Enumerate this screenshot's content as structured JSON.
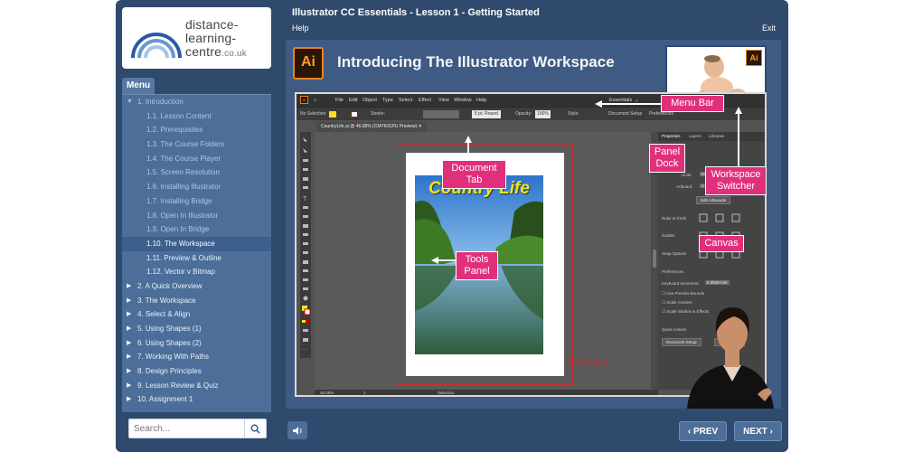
{
  "logo": {
    "line1": "distance-",
    "line2": "learning-",
    "line3": "centre",
    "line3_suffix": ".co.uk"
  },
  "header": {
    "course_title": "Illustrator CC Essentials - Lesson 1 - Getting Started",
    "help": "Help",
    "exit": "Exit"
  },
  "menu": {
    "tab_label": "Menu",
    "items": [
      {
        "label": "1. Introduction",
        "level": "top",
        "caret": "▼",
        "state": "open"
      },
      {
        "label": "1.1. Lesson Content",
        "level": "sub"
      },
      {
        "label": "1.2. Prerequisites",
        "level": "sub"
      },
      {
        "label": "1.3. The Course Folders",
        "level": "sub"
      },
      {
        "label": "1.4. The Course Player",
        "level": "sub"
      },
      {
        "label": "1.5. Screen Resolution",
        "level": "sub"
      },
      {
        "label": "1.6. Installing Illustrator",
        "level": "sub"
      },
      {
        "label": "1.7. Installing Bridge",
        "level": "sub"
      },
      {
        "label": "1.8. Open In Illustrator",
        "level": "sub"
      },
      {
        "label": "1.9. Open In Bridge",
        "level": "sub"
      },
      {
        "label": "1.10. The Workspace",
        "level": "sub",
        "state": "active"
      },
      {
        "label": "1.11. Preview & Outline",
        "level": "sub"
      },
      {
        "label": "1.12. Vector v Bitmap",
        "level": "sub"
      },
      {
        "label": "2. A Quick Overview",
        "level": "top",
        "caret": "▶"
      },
      {
        "label": "3. The Workspace",
        "level": "top",
        "caret": "▶"
      },
      {
        "label": "4. Select & Align",
        "level": "top",
        "caret": "▶"
      },
      {
        "label": "5. Using Shapes (1)",
        "level": "top",
        "caret": "▶"
      },
      {
        "label": "6. Using Shapes (2)",
        "level": "top",
        "caret": "▶"
      },
      {
        "label": "7. Working With Paths",
        "level": "top",
        "caret": "▶"
      },
      {
        "label": "8. Design Principles",
        "level": "top",
        "caret": "▶"
      },
      {
        "label": "9. Lesson Review & Quiz",
        "level": "top",
        "caret": "▶"
      },
      {
        "label": "10. Assignment 1",
        "level": "top",
        "caret": "▶"
      }
    ]
  },
  "search": {
    "placeholder": "Search..."
  },
  "slide": {
    "badge": "Ai",
    "title": "Introducing The Illustrator Workspace",
    "thumbnail_badge": "Ai",
    "illustrator": {
      "menu_items": [
        "File",
        "Edit",
        "Object",
        "Type",
        "Select",
        "Effect",
        "View",
        "Window",
        "Help"
      ],
      "workspace": "Essentials",
      "control_bar": {
        "selection": "No Selection",
        "stroke": "Stroke:",
        "brush": "5 pt. Round",
        "opacity": "Opacity:",
        "opacity_value": "100%",
        "style": "Style:",
        "document": "Document Setup",
        "preferences": "Preferences"
      },
      "doc_tab": "CountryLife.ai @ 46.08% (CMYK/GPU Preview)",
      "panel_tabs": [
        "Properties",
        "Layers",
        "Libraries"
      ],
      "panel": {
        "no_selection": "No Selection",
        "document": "Document",
        "units_label": "Units:",
        "units": "Millimeters",
        "artboard_label": "Artboard:",
        "artboard": "1",
        "edit_artboards": "Edit Artboards",
        "rulers": "Ruler & Grids",
        "guides": "Guides",
        "snap": "Snap Options",
        "preferences": "Preferences",
        "keyboard_inc": "Keyboard Increment:",
        "keyboard_value": "0.3528 mm",
        "use_preview": "Use Preview Bounds",
        "scale_corners": "Scale Corners",
        "scale_strokes": "Scale Strokes & Effects",
        "quick_actions": "Quick Actions",
        "document_setup": "Document Setup",
        "preferences_btn": "Preferences"
      },
      "status": {
        "zoom": "46.08%",
        "artboard": "1",
        "tool": "Selection"
      },
      "artboard_title": "Country Life"
    },
    "callouts": {
      "menu_bar": "Menu Bar",
      "document_tab": "Document Tab",
      "workspace_switcher": "Workspace Switcher",
      "panel_dock": "Panel Dock",
      "tools_panel": "Tools Panel",
      "canvas": "Canvas",
      "artboard": "Artboard"
    }
  },
  "footer": {
    "prev": "PREV",
    "next": "NEXT",
    "prev_icon": "‹",
    "next_icon": "›"
  },
  "colors": {
    "player_bg": "#2f4a6d",
    "menu_bg": "#4d6e99",
    "callout": "#e0307c",
    "artboard_label": "#d4231f"
  }
}
